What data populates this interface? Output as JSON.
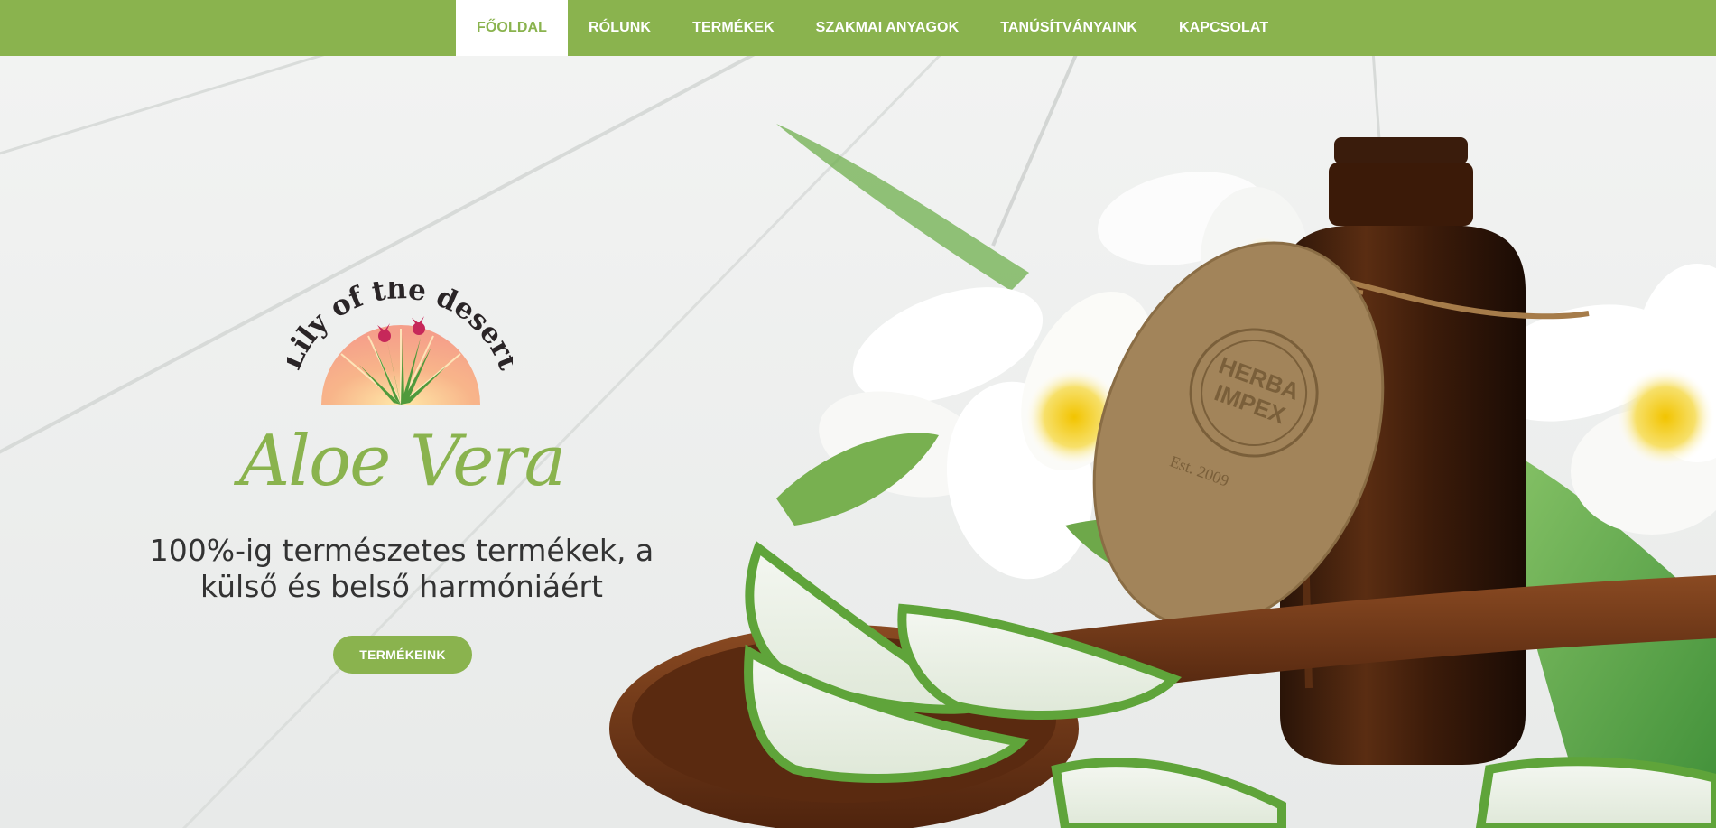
{
  "nav": {
    "items": [
      {
        "label": "FŐOLDAL",
        "active": true
      },
      {
        "label": "RÓLUNK",
        "active": false
      },
      {
        "label": "TERMÉKEK",
        "active": false
      },
      {
        "label": "SZAKMAI ANYAGOK",
        "active": false
      },
      {
        "label": "TANÚSÍTVÁNYAINK",
        "active": false
      },
      {
        "label": "KAPCSOLAT",
        "active": false
      }
    ]
  },
  "hero": {
    "logo_text": "Lily of the desert",
    "headline": "Aloe Vera",
    "tagline_line1": "100%-ig természetes termékek, a",
    "tagline_line2": "külső és belső harmóniáért",
    "cta_label": "TERMÉKEINK",
    "tag_stamp_line1": "HERBA",
    "tag_stamp_line2": "IMPEX",
    "tag_est": "Est. 2009"
  },
  "colors": {
    "brand_green": "#8ab34e",
    "text_dark": "#333333",
    "nav_active_bg": "#ffffff"
  },
  "icons": {
    "logo": "aloe-sunrise-logo"
  }
}
